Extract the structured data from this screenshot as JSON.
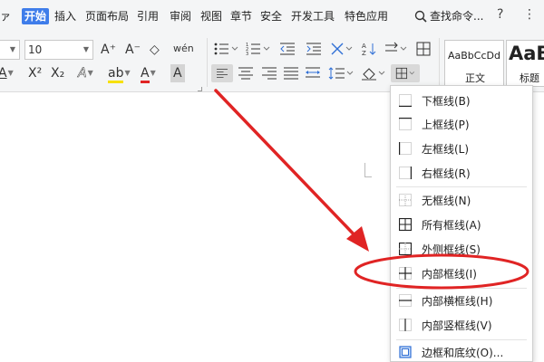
{
  "menubar": {
    "tab_prev": "ァ",
    "tab_start": "开始",
    "tab_insert": "插入",
    "tab_layout": "页面布局",
    "tab_ref": "引用",
    "tab_review": "审阅",
    "tab_view": "视图",
    "tab_chapter": "章节",
    "tab_security": "安全",
    "tab_dev": "开发工具",
    "tab_special": "特色应用",
    "search": "查找命令...",
    "help": "?",
    "more": "⋮"
  },
  "toolbar": {
    "font_size": "10",
    "font_name": "",
    "grow_font": "A⁺",
    "shrink_font": "A⁻",
    "clear_format": "◇",
    "phonetic": "wén",
    "superscript": "X²",
    "subscript": "X₂",
    "text_effect": "A",
    "highlight": "ab",
    "font_color": "A",
    "char_shading": "A",
    "style_sample_normal": "AaBbCcDd",
    "style_normal_label": "正文",
    "style_sample_heading": "AaB",
    "style_heading_label": "标题"
  },
  "colors": {
    "accent": "#3f7dea",
    "annotation": "#e02424",
    "highlight_bar": "#f7e000",
    "font_color_bar": "#e02424"
  },
  "border_menu": {
    "items": [
      {
        "label": "下框线(B)",
        "icon": "bottom-border-icon"
      },
      {
        "label": "上框线(P)",
        "icon": "top-border-icon"
      },
      {
        "label": "左框线(L)",
        "icon": "left-border-icon"
      },
      {
        "label": "右框线(R)",
        "icon": "right-border-icon"
      },
      {
        "label": "无框线(N)",
        "icon": "no-border-icon"
      },
      {
        "label": "所有框线(A)",
        "icon": "all-borders-icon"
      },
      {
        "label": "外侧框线(S)",
        "icon": "outside-borders-icon"
      },
      {
        "label": "内部框线(I)",
        "icon": "inside-borders-icon"
      },
      {
        "label": "内部横框线(H)",
        "icon": "inside-horizontal-border-icon"
      },
      {
        "label": "内部竖框线(V)",
        "icon": "inside-vertical-border-icon"
      },
      {
        "label": "边框和底纹(O)...",
        "icon": "borders-shading-icon"
      }
    ]
  }
}
